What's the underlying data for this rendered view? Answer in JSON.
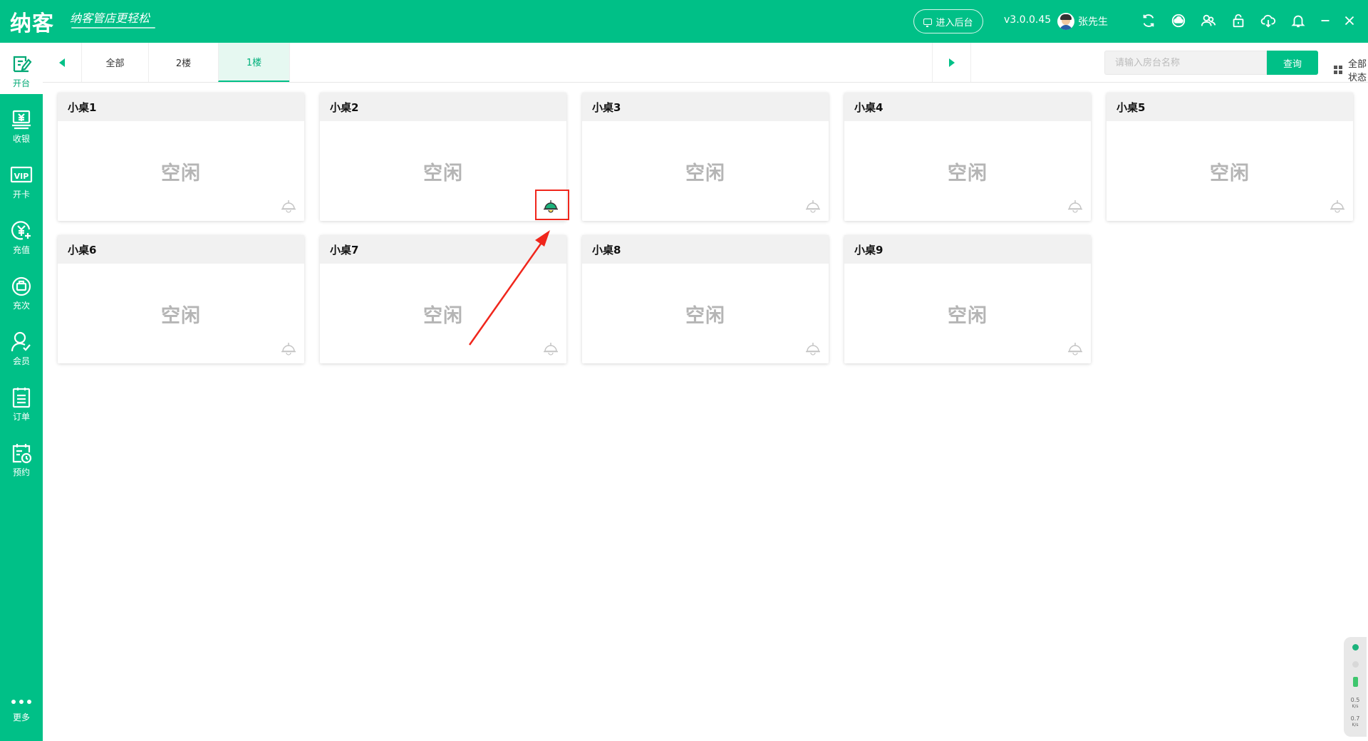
{
  "header": {
    "logo": "纳客",
    "slogan": "纳客管店更轻松",
    "enter_admin": "进入后台",
    "version": "v3.0.0.45",
    "username": "张先生"
  },
  "header_icons": [
    "refresh-icon",
    "sync-cloud-icon",
    "customer-service-icon",
    "lock-icon",
    "cloud-download-icon",
    "bell-icon",
    "minimize-icon",
    "close-icon"
  ],
  "sidebar": {
    "items": [
      {
        "label": "开台",
        "icon": "edit-table-icon"
      },
      {
        "label": "收银",
        "icon": "cashier-icon"
      },
      {
        "label": "开卡",
        "icon": "vip-card-icon"
      },
      {
        "label": "充值",
        "icon": "recharge-icon"
      },
      {
        "label": "充次",
        "icon": "recharge-times-icon"
      },
      {
        "label": "会员",
        "icon": "member-icon"
      },
      {
        "label": "订单",
        "icon": "order-icon"
      },
      {
        "label": "预约",
        "icon": "appointment-icon"
      }
    ],
    "more": "更多"
  },
  "tabs": [
    {
      "label": "全部"
    },
    {
      "label": "2楼"
    },
    {
      "label": "1楼"
    }
  ],
  "active_tab": "1楼",
  "search": {
    "placeholder": "请输入房台名称",
    "value": "",
    "button": "查询"
  },
  "status_filter": "全部状态",
  "tables": [
    {
      "name": "小桌1",
      "status": "空闲",
      "lamp": "off"
    },
    {
      "name": "小桌2",
      "status": "空闲",
      "lamp": "on"
    },
    {
      "name": "小桌3",
      "status": "空闲",
      "lamp": "off"
    },
    {
      "name": "小桌4",
      "status": "空闲",
      "lamp": "off"
    },
    {
      "name": "小桌5",
      "status": "空闲",
      "lamp": "off"
    },
    {
      "name": "小桌6",
      "status": "空闲",
      "lamp": "off"
    },
    {
      "name": "小桌7",
      "status": "空闲",
      "lamp": "off"
    },
    {
      "name": "小桌8",
      "status": "空闲",
      "lamp": "off"
    },
    {
      "name": "小桌9",
      "status": "空闲",
      "lamp": "off"
    }
  ],
  "network": {
    "upload": "0.5",
    "download": "0.7",
    "unit": "K/s"
  },
  "colors": {
    "brand": "#00c087",
    "highlight": "#f0261c",
    "status_text": "#b5b5b5",
    "lamp_on": "#1bb37c",
    "lamp_off": "#c4c4c4"
  }
}
